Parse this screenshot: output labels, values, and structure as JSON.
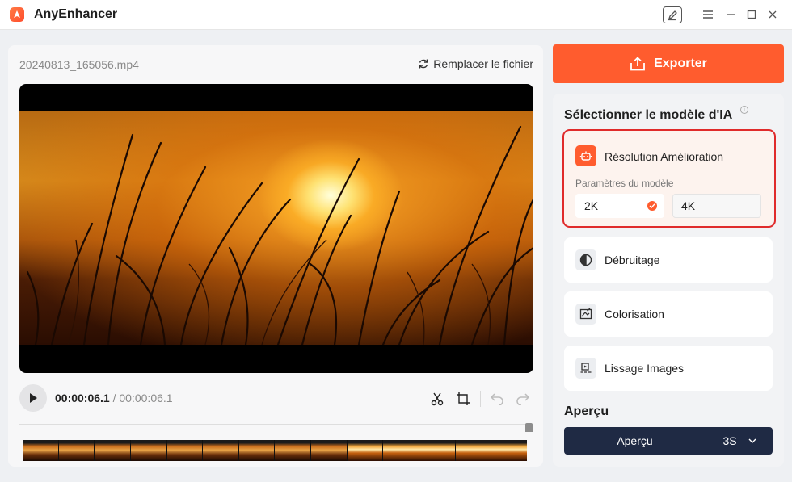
{
  "app": {
    "title": "AnyEnhancer"
  },
  "editor": {
    "file_name": "20240813_165056.mp4",
    "replace_label": "Remplacer le fichier",
    "time_current": "00:00:06.1",
    "time_separator": " / ",
    "time_total": "00:00:06.1"
  },
  "export": {
    "label": "Exporter"
  },
  "models": {
    "section_title": "Sélectionner le modèle d'IA",
    "resolution": {
      "label": "Résolution Amélioration",
      "params_label": "Paramètres du modèle",
      "options": [
        "2K",
        "4K"
      ],
      "selected": "2K"
    },
    "denoise": {
      "label": "Débruitage"
    },
    "colorize": {
      "label": "Colorisation"
    },
    "smooth": {
      "label": "Lissage Images"
    }
  },
  "preview": {
    "title": "Aperçu",
    "button_label": "Aperçu",
    "duration": "3S"
  },
  "colors": {
    "accent": "#ff5c2e",
    "selected_border": "#e02b2b",
    "preview_bar": "#1f2a44"
  }
}
